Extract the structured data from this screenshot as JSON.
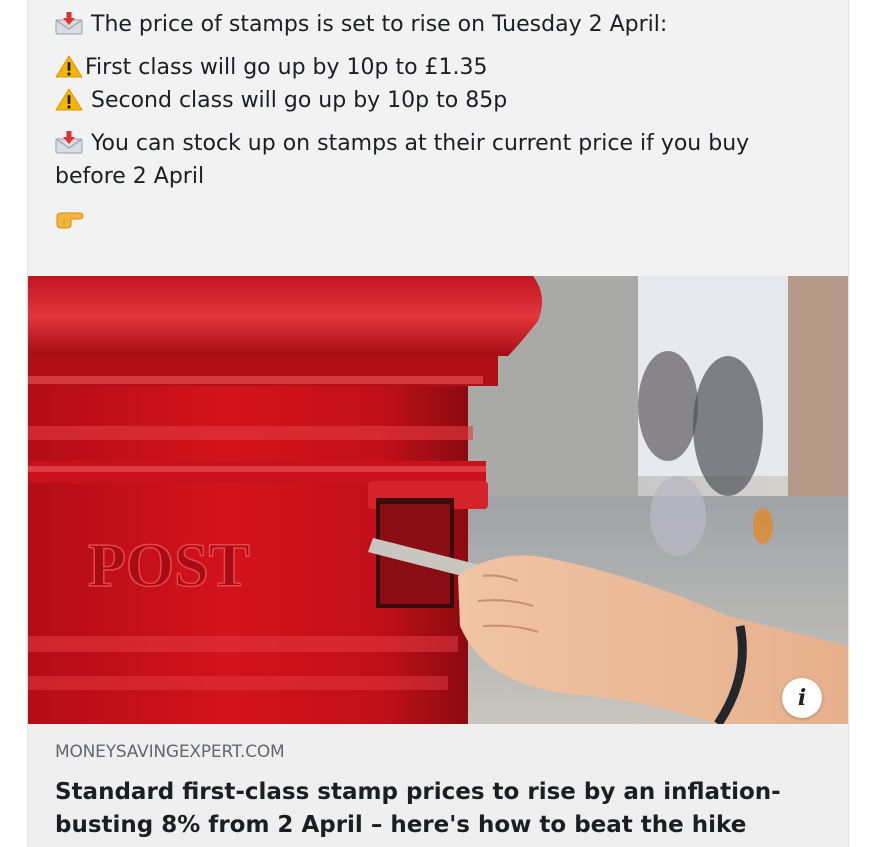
{
  "post": {
    "line1": "The price of stamps is set to rise on Tuesday 2 April:",
    "line2": "First class will go up by 10p to £1.35",
    "line3": "Second class will go up by 10p to 85p",
    "line4": "You can stock up on stamps at their current price if you buy before 2 April",
    "emoji_names": [
      "envelope-with-arrow-icon",
      "warning-icon",
      "warning-icon",
      "envelope-with-arrow-icon",
      "pointing-right-hand-icon"
    ]
  },
  "link_preview": {
    "image_subject": "post-box",
    "image_text": "POST",
    "domain": "MONEYSAVINGEXPERT.COM",
    "headline": "Standard first-class stamp prices to rise by an inflation-busting 8% from 2 April – here's how to beat the hike",
    "info_label": "i"
  },
  "colors": {
    "card_bg": "#f2f2f2",
    "text": "#1c1e21",
    "secondary_text": "#65676b",
    "postbox_red": "#c8101a"
  }
}
